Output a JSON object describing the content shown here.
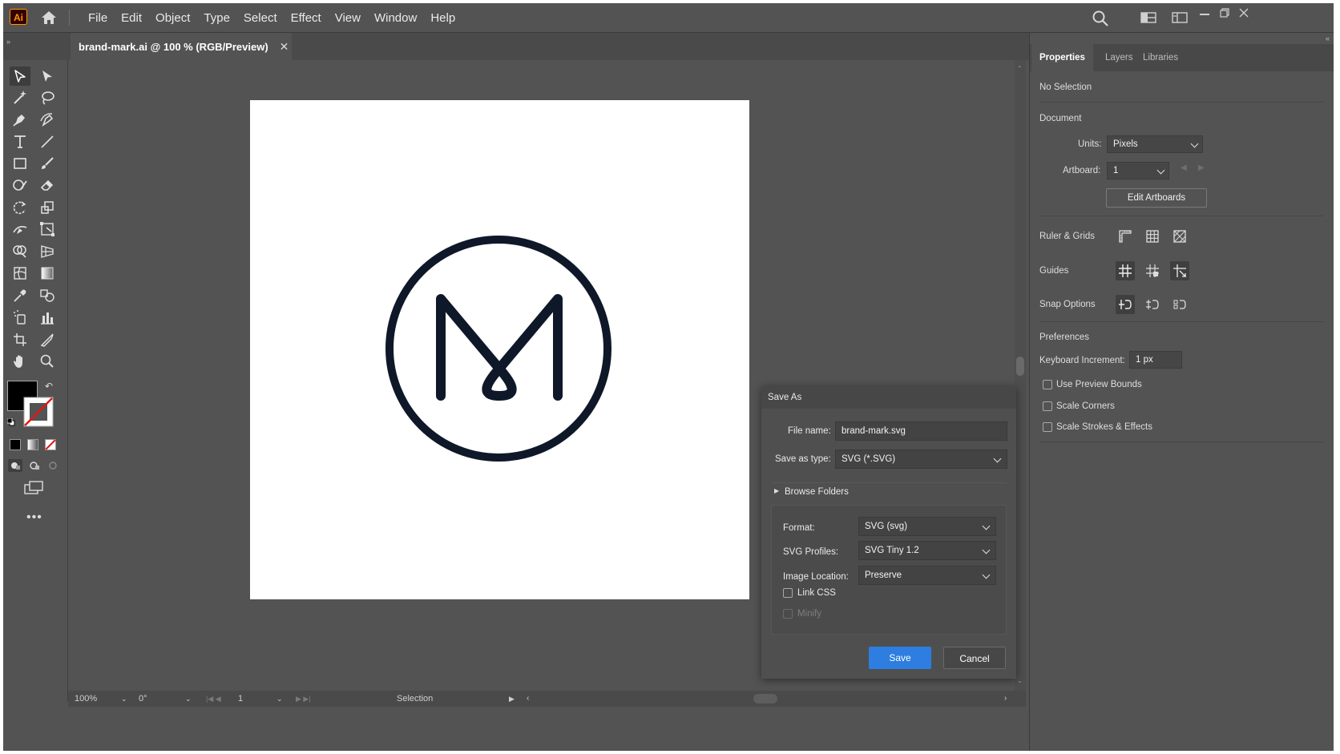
{
  "app": {
    "logo_text": "Ai",
    "accent": "#ff9a00"
  },
  "menu": [
    "File",
    "Edit",
    "Object",
    "Type",
    "Select",
    "Effect",
    "View",
    "Window",
    "Help"
  ],
  "document": {
    "tab_title": "brand-mark.ai @ 100 % (RGB/Preview)",
    "close": "✕"
  },
  "artwork": {
    "stroke_color": "#0f1828"
  },
  "status": {
    "zoom": "100%",
    "rotation": "0°",
    "artboard": "1",
    "tool": "Selection"
  },
  "properties": {
    "tabs": [
      "Properties",
      "Layers",
      "Libraries"
    ],
    "selection": "No Selection",
    "document_heading": "Document",
    "units_label": "Units:",
    "units_value": "Pixels",
    "artboard_label": "Artboard:",
    "artboard_value": "1",
    "edit_artboards": "Edit Artboards",
    "ruler_grids": "Ruler & Grids",
    "guides": "Guides",
    "snap_options": "Snap Options",
    "preferences": "Preferences",
    "keyboard_increment_label": "Keyboard Increment:",
    "keyboard_increment_value": "1 px",
    "use_preview_bounds": "Use Preview Bounds",
    "scale_corners": "Scale Corners",
    "scale_strokes": "Scale Strokes & Effects"
  },
  "dialog": {
    "title": "Save As",
    "file_name_label": "File name:",
    "file_name_value": "brand-mark.svg",
    "save_type_label": "Save as type:",
    "save_type_value": "SVG (*.SVG)",
    "browse_folders": "Browse Folders",
    "format_label": "Format:",
    "format_value": "SVG (svg)",
    "profiles_label": "SVG Profiles:",
    "profiles_value": "SVG Tiny 1.2",
    "image_location_label": "Image Location:",
    "image_location_value": "Preserve",
    "link_css": "Link CSS",
    "minify": "Minify",
    "save": "Save",
    "cancel": "Cancel",
    "save_color": "#2d7ee0"
  }
}
